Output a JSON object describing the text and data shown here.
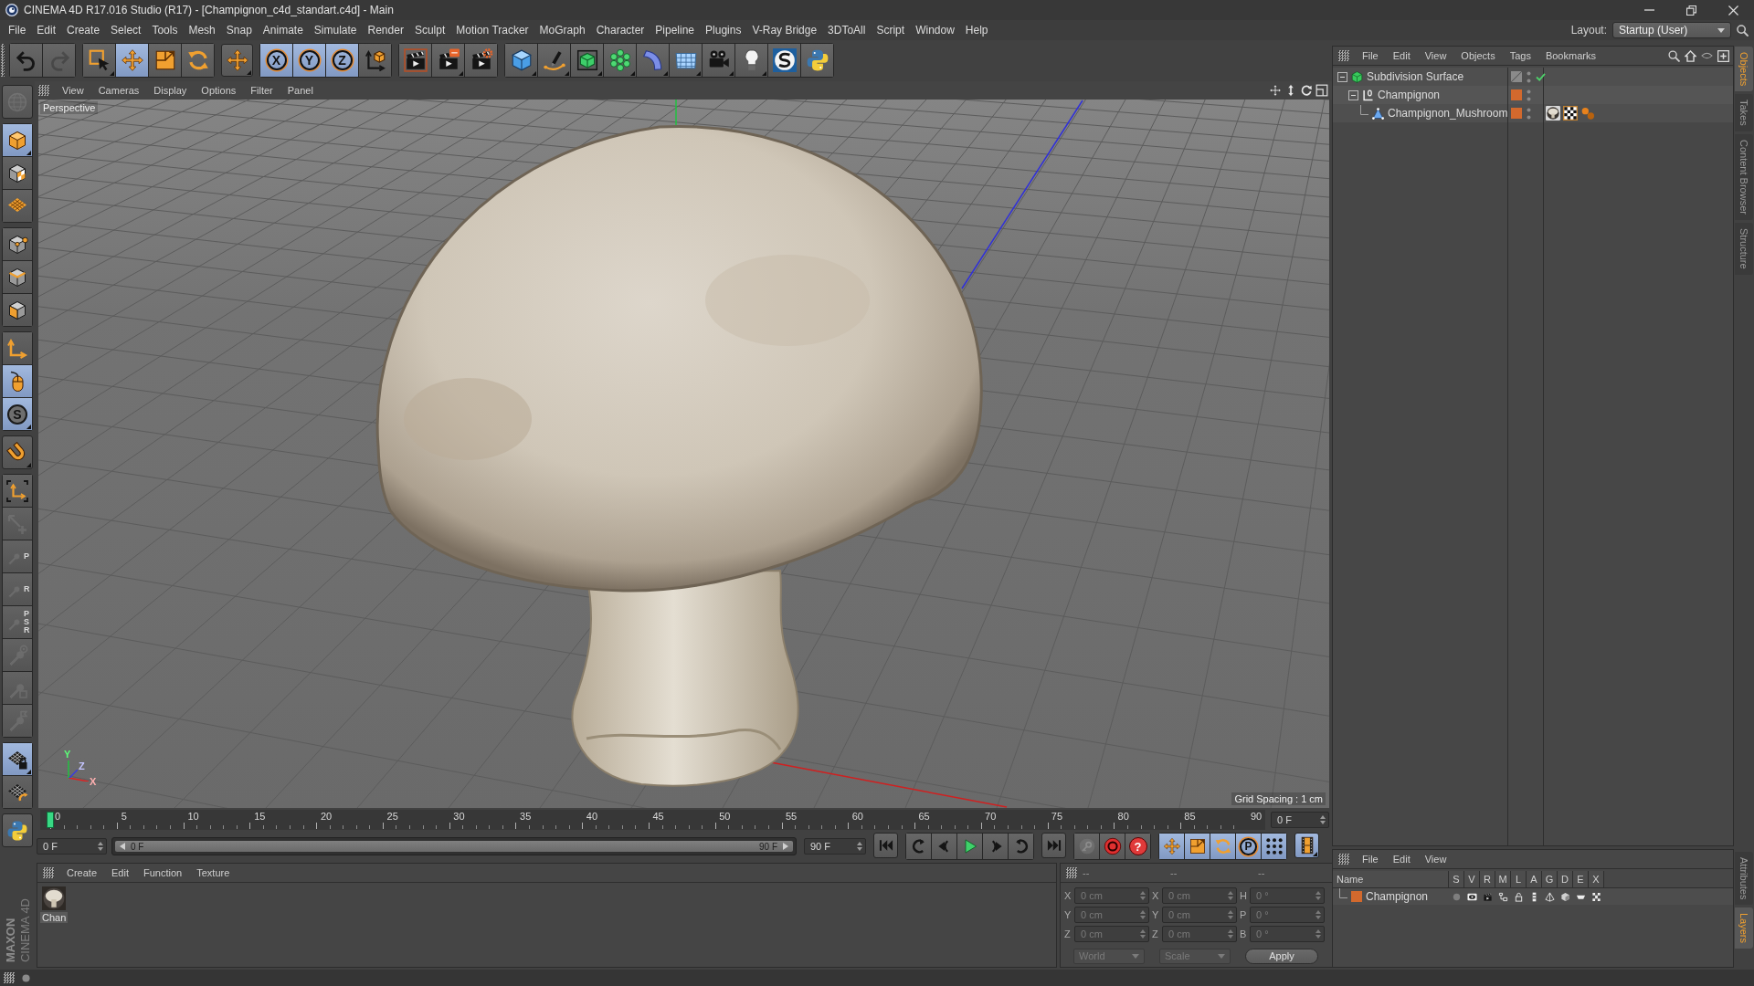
{
  "window": {
    "title": "CINEMA 4D R17.016 Studio (R17) - [Champignon_c4d_standart.c4d] - Main"
  },
  "menu_bar": {
    "items": [
      "File",
      "Edit",
      "Create",
      "Select",
      "Tools",
      "Mesh",
      "Snap",
      "Animate",
      "Simulate",
      "Render",
      "Sculpt",
      "Motion Tracker",
      "MoGraph",
      "Character",
      "Pipeline",
      "Plugins",
      "V-Ray Bridge",
      "3DToAll",
      "Script",
      "Window",
      "Help"
    ],
    "layout_label": "Layout:",
    "layout_value": "Startup (User)"
  },
  "toolbar": {
    "buttons": [
      {
        "on": false,
        "disabled": false
      },
      {
        "on": false,
        "disabled": true
      },
      {
        "on": false,
        "disabled": false
      },
      {
        "on": true,
        "disabled": false
      },
      {
        "on": false,
        "disabled": false
      },
      {
        "on": false,
        "disabled": false
      },
      {
        "on": false,
        "disabled": false
      },
      {
        "label": "X",
        "on": true,
        "disabled": false
      },
      {
        "label": "Y",
        "on": true,
        "disabled": false
      },
      {
        "label": "Z",
        "on": true,
        "disabled": false
      },
      {
        "on": false,
        "disabled": false
      },
      {
        "on": false,
        "disabled": false
      },
      {
        "on": false,
        "disabled": false
      },
      {
        "on": false,
        "disabled": false
      },
      {
        "on": false,
        "disabled": false
      },
      {
        "on": false,
        "disabled": false
      },
      {
        "on": false,
        "disabled": false
      },
      {
        "on": false,
        "disabled": false
      },
      {
        "on": false,
        "disabled": false
      },
      {
        "on": false,
        "disabled": false
      },
      {
        "on": false,
        "disabled": false
      },
      {
        "on": false,
        "disabled": false
      },
      {
        "on": false,
        "disabled": false
      },
      {
        "on": false,
        "disabled": false
      }
    ]
  },
  "mode_toolbar": {
    "buttons": [
      {
        "on": false,
        "disabled": true
      },
      {
        "on": true,
        "disabled": false
      },
      {
        "on": false,
        "disabled": false
      },
      {
        "on": false,
        "disabled": false
      },
      {
        "on": false,
        "disabled": false
      },
      {
        "on": false,
        "disabled": false
      },
      {
        "on": false,
        "disabled": false
      },
      {
        "on": false,
        "disabled": false
      },
      {
        "on": true,
        "disabled": false
      },
      {
        "label": "S",
        "on": true,
        "disabled": false
      },
      {
        "on": false,
        "disabled": false
      },
      {
        "on": false,
        "disabled": false
      },
      {
        "on": false,
        "disabled": true
      },
      {
        "label": "P",
        "on": false,
        "disabled": true
      },
      {
        "label": "R",
        "on": false,
        "disabled": true
      },
      {
        "label": "PSR",
        "on": false,
        "disabled": true
      },
      {
        "on": false,
        "disabled": true
      },
      {
        "on": false,
        "disabled": true
      },
      {
        "on": false,
        "disabled": true
      },
      {
        "on": true,
        "disabled": false
      },
      {
        "on": false,
        "disabled": false
      },
      {
        "on": false,
        "disabled": false
      }
    ]
  },
  "viewport": {
    "menu": [
      "View",
      "Cameras",
      "Display",
      "Options",
      "Filter",
      "Panel"
    ],
    "camera": "Perspective",
    "grid_spacing": "Grid Spacing : 1 cm",
    "axis_labels": [
      "Y",
      "Z",
      "X"
    ]
  },
  "timeline": {
    "ticks": [
      "0",
      "5",
      "10",
      "15",
      "20",
      "25",
      "30",
      "35",
      "40",
      "45",
      "50",
      "55",
      "60",
      "65",
      "70",
      "75",
      "80",
      "85",
      "90"
    ],
    "playhead": {
      "level": 0
    },
    "current_frame": "0 F"
  },
  "playback": {
    "start_field": "0 F",
    "range_slider": {
      "level": 1,
      "start": "0 F",
      "end": "90 F"
    },
    "end_field": "90 F",
    "buttons": [
      {
        "on": false,
        "disabled": false
      },
      {
        "on": false,
        "disabled": false
      },
      {
        "on": false,
        "disabled": false
      },
      {
        "on": false,
        "disabled": false
      },
      {
        "on": false,
        "disabled": false
      },
      {
        "on": false,
        "disabled": false
      },
      {
        "on": false,
        "disabled": false
      },
      {
        "on": false,
        "disabled": true
      },
      {
        "on": false,
        "disabled": false
      },
      {
        "label": "?",
        "on": false,
        "disabled": false
      },
      {
        "on": true,
        "disabled": false
      },
      {
        "on": true,
        "disabled": false
      },
      {
        "on": true,
        "disabled": false
      },
      {
        "label": "P",
        "on": true,
        "disabled": false
      },
      {
        "on": true,
        "disabled": false
      },
      {
        "on": true,
        "disabled": false
      }
    ]
  },
  "material_manager": {
    "menu": [
      "Create",
      "Edit",
      "Function",
      "Texture"
    ],
    "materials": [
      {
        "name": "Chan"
      }
    ]
  },
  "coordinates": {
    "headers": [
      "--",
      "--",
      "--"
    ],
    "rows": [
      {
        "position_axis": "X",
        "position": "0 cm",
        "size_axis": "X",
        "size": "0 cm",
        "rotation_axis": "H",
        "rotation": "0 °"
      },
      {
        "position_axis": "Y",
        "position": "0 cm",
        "size_axis": "Y",
        "size": "0 cm",
        "rotation_axis": "P",
        "rotation": "0 °"
      },
      {
        "position_axis": "Z",
        "position": "0 cm",
        "size_axis": "Z",
        "size": "0 cm",
        "rotation_axis": "B",
        "rotation": "0 °"
      }
    ],
    "space_dropdown": "World",
    "size_dropdown": "Scale",
    "apply_button": "Apply"
  },
  "object_manager": {
    "menu": [
      "File",
      "Edit",
      "View",
      "Objects",
      "Tags",
      "Bookmarks"
    ],
    "objects": [
      {
        "name": "Subdivision Surface",
        "kind": "generator",
        "expanded": true,
        "enabled": true,
        "children": [
          {
            "name": "Champignon",
            "kind": "null",
            "expanded": true,
            "color": "#d2692d",
            "children": [
              {
                "name": "Champignon_Mushroom",
                "kind": "polygon",
                "color": "#d2692d",
                "tags": [
                  {
                    "kind": "material"
                  },
                  {
                    "kind": "uvw"
                  },
                  {
                    "kind": "points"
                  }
                ]
              }
            ]
          }
        ]
      }
    ]
  },
  "layer_manager": {
    "menu": [
      "File",
      "Edit",
      "View"
    ],
    "columns": [
      "Name",
      "S",
      "V",
      "R",
      "M",
      "L",
      "A",
      "G",
      "D",
      "E",
      "X"
    ],
    "layers": [
      {
        "name": "Champignon",
        "color": "#d2692d",
        "switches": [
          {
            "on": false
          },
          {
            "on": true
          },
          {
            "on": true
          },
          {
            "on": true
          },
          {
            "on": true
          },
          {
            "on": true
          },
          {
            "on": true
          },
          {
            "on": true
          },
          {
            "on": true
          },
          {
            "on": true
          }
        ]
      }
    ]
  },
  "dock_tabs_top": [
    {
      "label": "Objects",
      "selected": true
    },
    {
      "label": "Takes",
      "selected": false
    },
    {
      "label": "Content Browser",
      "selected": false
    },
    {
      "label": "Structure",
      "selected": false
    }
  ],
  "dock_tabs_bottom": [
    {
      "label": "Attributes",
      "selected": false
    },
    {
      "label": "Layers",
      "selected": true
    }
  ],
  "brand": {
    "company": "MAXON",
    "product": "CINEMA 4D"
  }
}
